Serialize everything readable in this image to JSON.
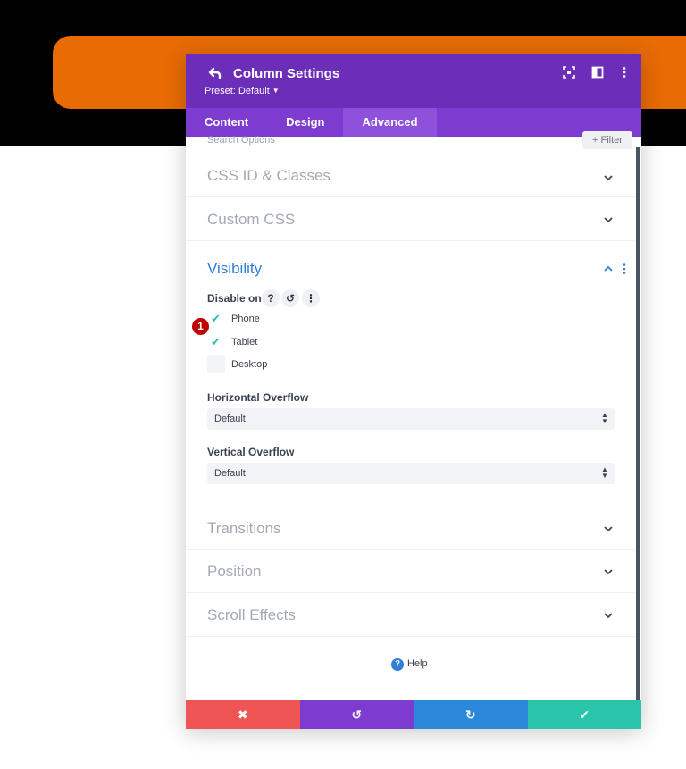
{
  "colors": {
    "header_purple": "#6c2eb9",
    "tab_purple": "#7e3bd0",
    "tab_active": "#8f51dc",
    "background_orange": "#e86b04",
    "accent_blue": "#2f7ed8",
    "discard_red": "#ef5555",
    "undo_purple": "#7e3bd0",
    "redo_blue": "#2b87da",
    "save_green": "#29c4a9"
  },
  "header": {
    "title": "Column Settings",
    "preset": "Preset: Default",
    "icons": [
      "back-arrow-icon",
      "fullscreen-icon",
      "split-view-icon",
      "more-options-icon"
    ]
  },
  "tabs": [
    {
      "label": "Content",
      "active": false
    },
    {
      "label": "Design",
      "active": false
    },
    {
      "label": "Advanced",
      "active": true
    }
  ],
  "search": {
    "placeholder": "Search Options",
    "filter_label": "Filter"
  },
  "sections": {
    "css_id": "CSS ID & Classes",
    "custom_css": "Custom CSS",
    "visibility": "Visibility",
    "transitions": "Transitions",
    "position": "Position",
    "scroll_effects": "Scroll Effects"
  },
  "visibility": {
    "disable_on_label": "Disable on",
    "options": [
      {
        "label": "Phone",
        "checked": true
      },
      {
        "label": "Tablet",
        "checked": true
      },
      {
        "label": "Desktop",
        "checked": false
      }
    ],
    "badge": "1",
    "horizontal_overflow": {
      "label": "Horizontal Overflow",
      "value": "Default"
    },
    "vertical_overflow": {
      "label": "Vertical Overflow",
      "value": "Default"
    }
  },
  "help_label": "Help",
  "footer": {
    "discard": "✖",
    "undo": "↺",
    "redo": "↻",
    "save": "✔"
  }
}
